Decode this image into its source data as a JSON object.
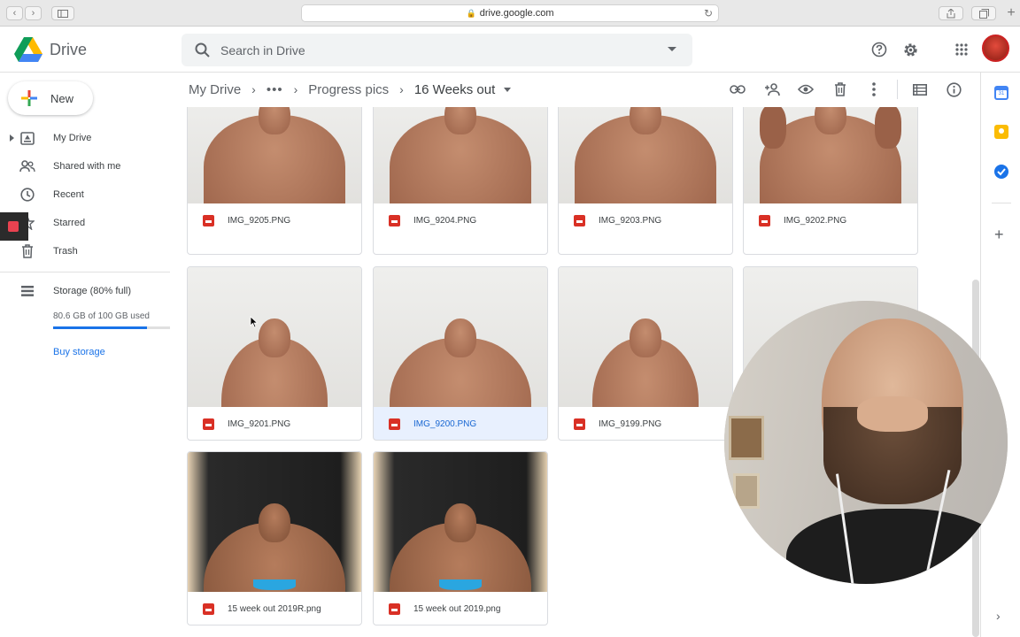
{
  "browser": {
    "url": "drive.google.com"
  },
  "header": {
    "app_name": "Drive",
    "search_placeholder": "Search in Drive",
    "help_icon": "help-circle-icon",
    "settings_icon": "gear-icon",
    "apps_icon": "grid-apps-icon"
  },
  "sidebar": {
    "new_label": "New",
    "items": [
      {
        "label": "My Drive",
        "icon": "my-drive-icon"
      },
      {
        "label": "Shared with me",
        "icon": "people-icon"
      },
      {
        "label": "Recent",
        "icon": "clock-icon"
      },
      {
        "label": "Starred",
        "icon": "star-icon"
      },
      {
        "label": "Trash",
        "icon": "trash-icon"
      }
    ],
    "storage": {
      "label": "Storage (80% full)",
      "used_text": "80.6 GB of 100 GB used",
      "used_fraction": 0.806,
      "buy_label": "Buy storage"
    }
  },
  "breadcrumb": {
    "root": "My Drive",
    "more": "•••",
    "parent": "Progress pics",
    "current": "16 Weeks out"
  },
  "toolbar": {
    "icons": [
      "link-icon",
      "add-person-icon",
      "eye-icon",
      "trash-icon",
      "more-vert-icon",
      "list-view-icon",
      "info-icon"
    ]
  },
  "files": [
    {
      "name": "IMG_9205.PNG",
      "pose": "back",
      "bg": "light",
      "selected": false
    },
    {
      "name": "IMG_9204.PNG",
      "pose": "front-relaxed",
      "bg": "light",
      "selected": false
    },
    {
      "name": "IMG_9203.PNG",
      "pose": "front-lat",
      "bg": "light",
      "selected": false
    },
    {
      "name": "IMG_9202.PNG",
      "pose": "double-bicep",
      "bg": "light",
      "selected": false
    },
    {
      "name": "IMG_9201.PNG",
      "pose": "side",
      "bg": "light",
      "selected": false
    },
    {
      "name": "IMG_9200.PNG",
      "pose": "back-lat",
      "bg": "light",
      "selected": true
    },
    {
      "name": "IMG_9199.PNG",
      "pose": "side",
      "bg": "light",
      "selected": false
    },
    {
      "name": "",
      "pose": "hidden",
      "bg": "light",
      "selected": false
    },
    {
      "name": "15 week out 2019R.png",
      "pose": "back-stage",
      "bg": "dark",
      "selected": false
    },
    {
      "name": "15 week out 2019.png",
      "pose": "front-stage",
      "bg": "dark",
      "selected": false
    }
  ],
  "colors": {
    "accent": "#1a73e8",
    "file_icon": "#d93025",
    "selected_bg": "#e8f0fe"
  }
}
